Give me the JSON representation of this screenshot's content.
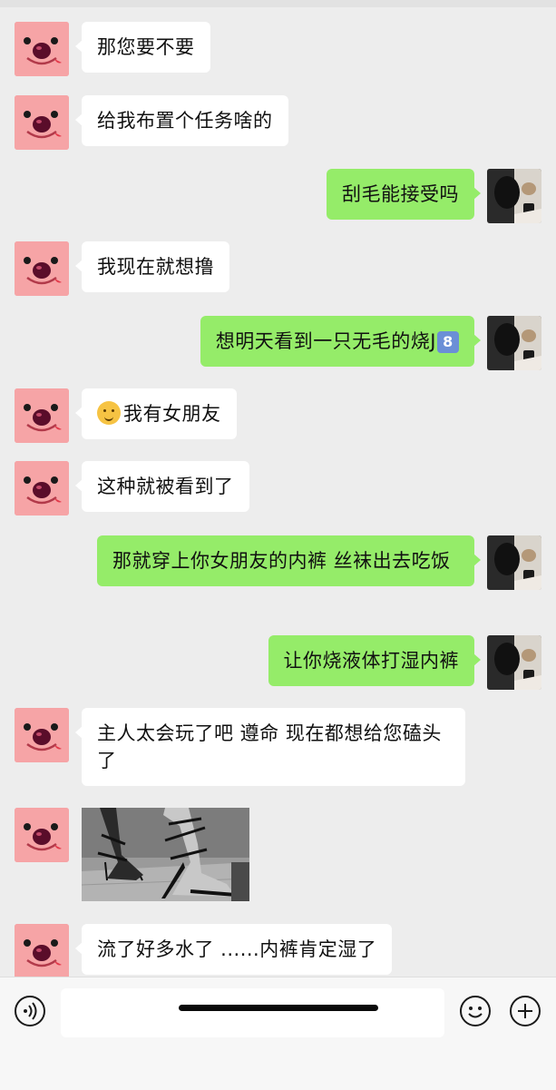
{
  "conversation": {
    "messages": [
      {
        "from": "contact",
        "kind": "text",
        "text": "那您要不要"
      },
      {
        "from": "contact",
        "kind": "text",
        "text": "给我布置个任务啥的"
      },
      {
        "from": "me",
        "kind": "text",
        "text": "刮毛能接受吗"
      },
      {
        "from": "contact",
        "kind": "text",
        "text": "我现在就想撸"
      },
      {
        "from": "me",
        "kind": "text",
        "text": "想明天看到一只无毛的烧J",
        "suffix_keycap": "8"
      },
      {
        "from": "contact",
        "kind": "text",
        "prefix_emoji": "smiling-face-emoji",
        "text": "我有女朋友"
      },
      {
        "from": "contact",
        "kind": "text",
        "text": "这种就被看到了"
      },
      {
        "from": "me",
        "kind": "text",
        "text": "那就穿上你女朋友的内裤 丝袜出去吃饭"
      },
      {
        "from": "me",
        "kind": "text",
        "text": "让你烧液体打湿内裤"
      },
      {
        "from": "contact",
        "kind": "text",
        "text": "主人太会玩了吧 遵命 现在都想给您磕头了"
      },
      {
        "from": "contact",
        "kind": "image",
        "image_subject": "high-heel-sandals-photo"
      },
      {
        "from": "contact",
        "kind": "text",
        "text": "流了好多水了 ......内裤肯定湿了"
      }
    ]
  },
  "input_bar": {
    "voice_icon": "voice-wave-icon",
    "text_value": "",
    "emoji_icon": "smiley-face-icon",
    "more_icon": "plus-circle-icon"
  },
  "colors": {
    "background": "#ededed",
    "incoming_bubble": "#ffffff",
    "outgoing_bubble": "#95ec69",
    "contact_avatar": "#f6a4a6"
  }
}
